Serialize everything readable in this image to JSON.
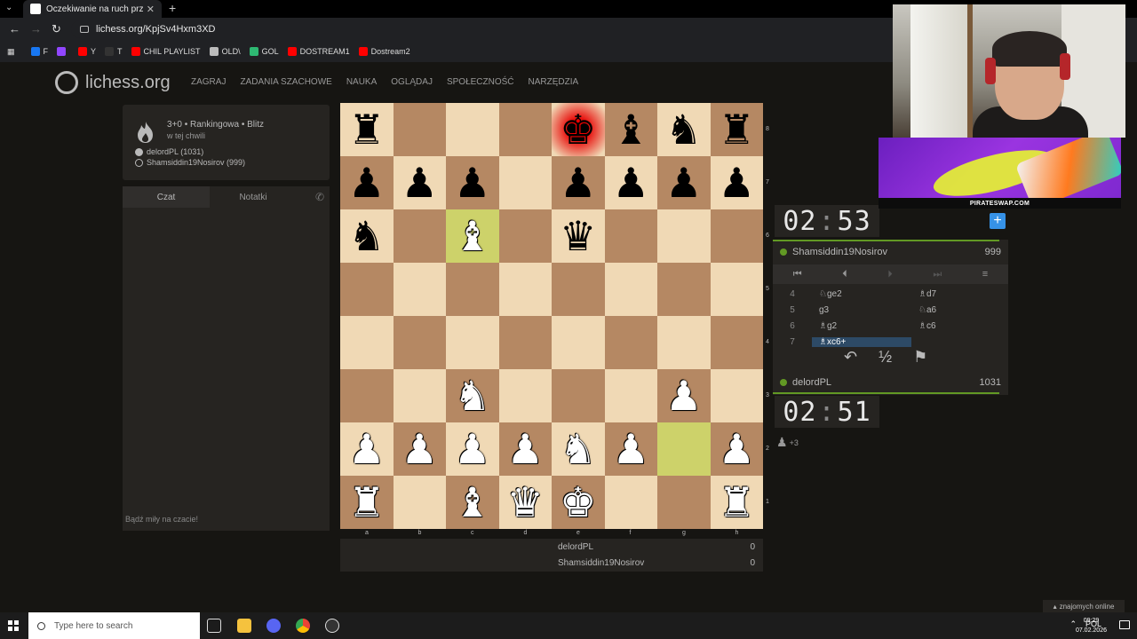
{
  "browser": {
    "tab_title": "Oczekiwanie na ruch przeciwnika",
    "url": "lichess.org/KpjSv4Hxm3XD",
    "bookmarks": [
      {
        "label": "F",
        "color": "#1877f2"
      },
      {
        "label": "",
        "color": "#9146ff"
      },
      {
        "label": "Y",
        "color": "#ff0000"
      },
      {
        "label": "T",
        "color": "#333333"
      },
      {
        "label": "CHIL PLAYLIST",
        "color": "#ff0000"
      },
      {
        "label": "OLD\\",
        "color": "#bbbbbb"
      },
      {
        "label": "GOL",
        "color": "#2eb872"
      },
      {
        "label": "DOSTREAM1",
        "color": "#ff0000"
      },
      {
        "label": "Dostream2",
        "color": "#ff0000"
      }
    ]
  },
  "site": {
    "logo": "lichess.org",
    "nav": [
      "ZAGRAJ",
      "ZADANIA SZACHOWE",
      "NAUKA",
      "OGLĄDAJ",
      "SPOŁECZNOŚĆ",
      "NARZĘDZIA"
    ]
  },
  "game_info": {
    "title": "3+0 • Rankingowa • Blitz",
    "time": "w tej chwili",
    "white": "delordPL (1031)",
    "black": "Shamsiddin19Nosirov (999)"
  },
  "chat": {
    "tab_chat": "Czat",
    "tab_notes": "Notatki",
    "placeholder": "Bądź miły na czacie!"
  },
  "board": {
    "pieces": [
      [
        "r",
        "",
        "",
        "",
        "k",
        "b",
        "n",
        "r"
      ],
      [
        "p",
        "p",
        "p",
        "",
        "p",
        "p",
        "p",
        "p"
      ],
      [
        "n",
        "",
        "B",
        "",
        "q",
        "",
        "",
        ""
      ],
      [
        "",
        "",
        "",
        "",
        "",
        "",
        "",
        ""
      ],
      [
        "",
        "",
        "",
        "",
        "",
        "",
        "",
        ""
      ],
      [
        "",
        "",
        "N",
        "",
        "",
        "",
        "P",
        ""
      ],
      [
        "P",
        "P",
        "P",
        "P",
        "N",
        "P",
        "",
        "P"
      ],
      [
        "R",
        "",
        "B",
        "Q",
        "K",
        "",
        "",
        "R"
      ]
    ],
    "highlight": [
      "c6",
      "g2"
    ],
    "check": "e8",
    "ranks": [
      "8",
      "7",
      "6",
      "5",
      "4",
      "3",
      "2",
      "1"
    ],
    "files": [
      "a",
      "b",
      "c",
      "d",
      "e",
      "f",
      "g",
      "h"
    ]
  },
  "scores": [
    {
      "name": "delordPL",
      "score": "0"
    },
    {
      "name": "Shamsiddin19Nosirov",
      "score": "0"
    }
  ],
  "right_panel": {
    "top_clock": {
      "min": "02",
      "sec": "53"
    },
    "bottom_clock": {
      "min": "02",
      "sec": "51"
    },
    "top_player": {
      "name": "Shamsiddin19Nosirov",
      "rating": "999"
    },
    "bottom_player": {
      "name": "delordPL",
      "rating": "1031"
    },
    "moves": [
      {
        "no": "4",
        "white": "♘ge2",
        "black": "♗d7"
      },
      {
        "no": "5",
        "white": "g3",
        "black": "♘a6"
      },
      {
        "no": "6",
        "white": "♗g2",
        "black": "♗c6"
      },
      {
        "no": "7",
        "white": "♗xc6+",
        "black": ""
      }
    ],
    "captured": "+3"
  },
  "overlay": {
    "ad_text": "PIRATESWAP.COM"
  },
  "friends": "znajomych online",
  "taskbar": {
    "search_placeholder": "Type here to search",
    "lang": "POL",
    "time": "09:29",
    "date": "07.02.2026"
  }
}
